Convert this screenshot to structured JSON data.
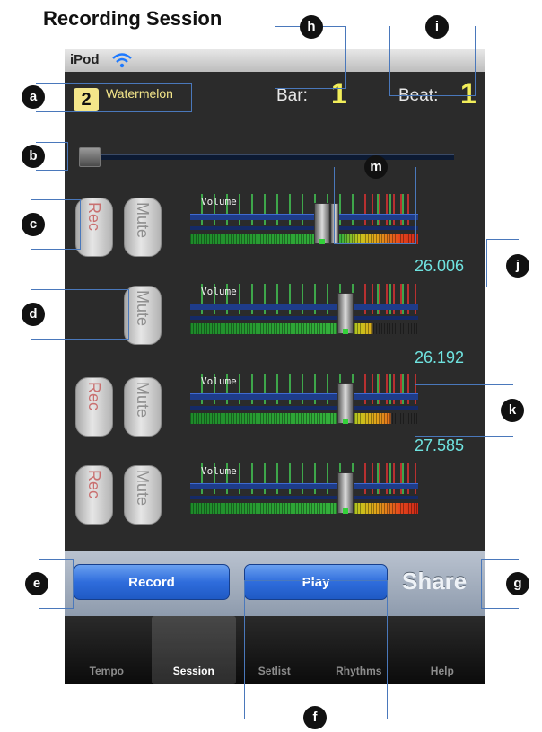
{
  "title": "Recording Session",
  "status": {
    "device": "iPod"
  },
  "song": {
    "number": "2",
    "name": "Watermelon"
  },
  "position": {
    "bar_label": "Bar:",
    "bar_value": "1",
    "beat_label": "Beat:",
    "beat_value": "1"
  },
  "tracks": [
    {
      "rec": "Rec",
      "mute": "Mute",
      "volume_label": "Volume",
      "value": "26.006"
    },
    {
      "mute": "Mute",
      "volume_label": "Volume",
      "value": "26.192"
    },
    {
      "rec": "Rec",
      "mute": "Mute",
      "volume_label": "Volume",
      "value": "27.585"
    },
    {
      "rec": "Rec",
      "mute": "Mute",
      "volume_label": "Volume"
    }
  ],
  "toolbar": {
    "record": "Record",
    "play": "Play",
    "share": "Share"
  },
  "tabs": [
    "Tempo",
    "Session",
    "Setlist",
    "Rhythms",
    "Help"
  ],
  "selected_tab": "Session",
  "callouts": {
    "a": "a",
    "b": "b",
    "c": "c",
    "d": "d",
    "e": "e",
    "f": "f",
    "g": "g",
    "h": "h",
    "i": "i",
    "j": "j",
    "k": "k",
    "m": "m"
  },
  "colors": {
    "accent_yellow": "#f2ee5a",
    "value_cyan": "#6fe3e0",
    "button_blue": "#2f6ddc",
    "callout_line": "#4a78bb"
  },
  "icons": {
    "wifi": "wifi-icon"
  }
}
